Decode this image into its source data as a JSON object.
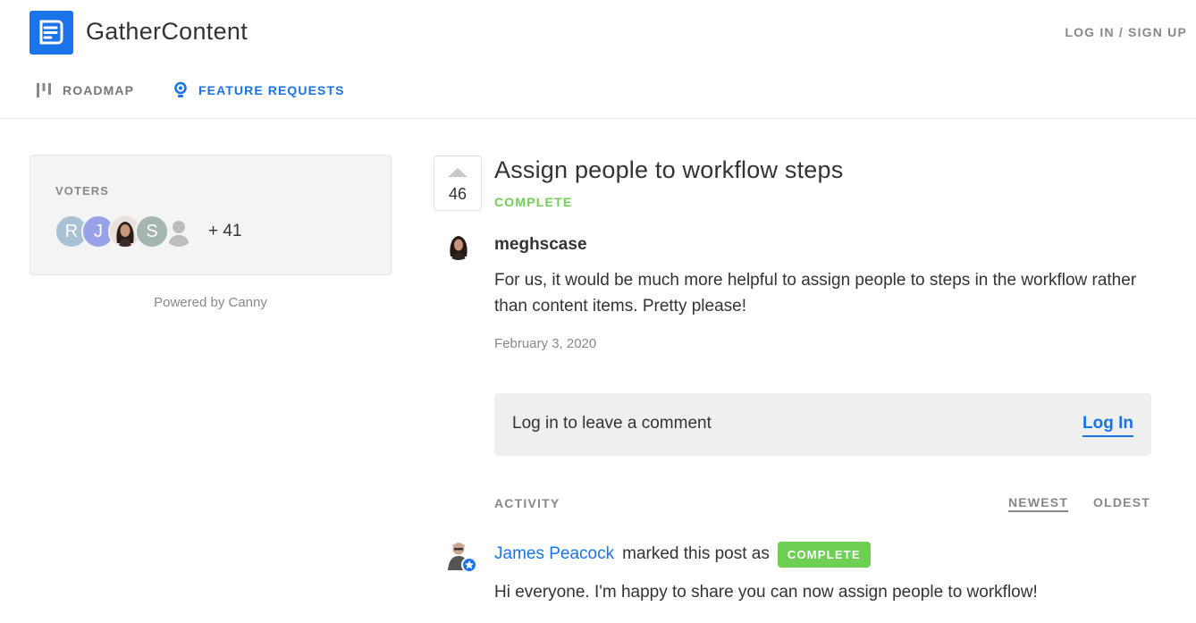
{
  "header": {
    "brand": "GatherContent",
    "login_label": "LOG IN / SIGN UP",
    "nav": [
      {
        "label": "ROADMAP",
        "icon": "roadmap-bars-icon"
      },
      {
        "label": "FEATURE REQUESTS",
        "icon": "lightbulb-icon"
      }
    ]
  },
  "sidebar": {
    "voters_title": "VOTERS",
    "avatars": [
      {
        "initial": "R",
        "color": "#a9c1d4"
      },
      {
        "initial": "J",
        "color": "#97a3e6"
      },
      {
        "initial": "",
        "type": "photo"
      },
      {
        "initial": "S",
        "color": "#a4b5b2"
      },
      {
        "initial": "",
        "type": "anonymous"
      }
    ],
    "extra_count": "+ 41",
    "powered_by": "Powered by Canny"
  },
  "post": {
    "vote_count": "46",
    "title": "Assign people to workflow steps",
    "status": "COMPLETE",
    "author": "meghscase",
    "body": "For us, it would be much more helpful to assign people to steps in the workflow rather than content items. Pretty please!",
    "date": "February 3, 2020"
  },
  "comment": {
    "prompt": "Log in to leave a comment",
    "login_label": "Log In"
  },
  "activity": {
    "label": "ACTIVITY",
    "sort_newest": "NEWEST",
    "sort_oldest": "OLDEST",
    "items": [
      {
        "user": "James Peacock",
        "action": "marked this post as",
        "status": "COMPLETE",
        "body": "Hi everyone. I'm happy to share you can now assign people to workflow!"
      }
    ]
  },
  "colors": {
    "accent": "#1a73e8",
    "complete": "#6fcf55",
    "muted": "#888888"
  }
}
